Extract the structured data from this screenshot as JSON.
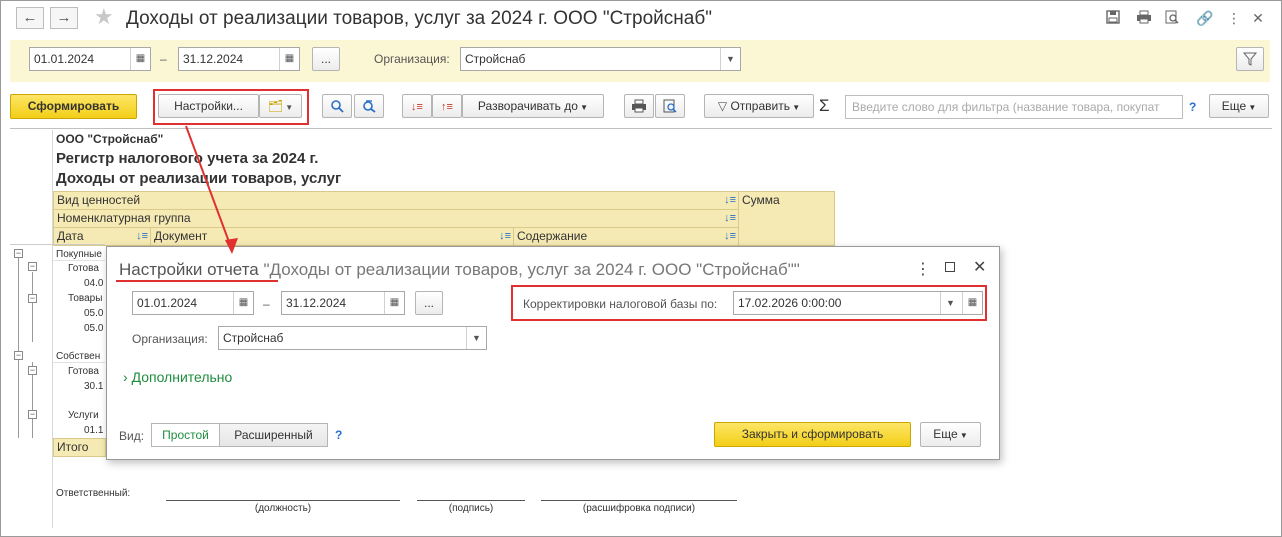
{
  "window": {
    "title": "Доходы от реализации товаров, услуг за 2024 г. ООО \"Стройснаб\"",
    "back_icon": "arrow-left-icon",
    "forward_icon": "arrow-right-icon",
    "more_icon": "more-vertical-icon"
  },
  "toolbar": {
    "date_from": "01.01.2024",
    "dash": "–",
    "date_to": "31.12.2024",
    "ellipsis": "...",
    "org_label": "Организация:",
    "org_value": "Стройснаб",
    "form_button": "Сформировать",
    "settings_button": "Настройки...",
    "expand_to_button": "Разворачивать до",
    "send_button": "Отправить",
    "sum_symbol": "Σ",
    "filter_placeholder": "Введите слово для фильтра (название товара, покупат",
    "help": "?",
    "more_button": "Еще"
  },
  "report": {
    "org": "ООО \"Стройснаб\"",
    "register_title": "Регистр налогового учета за 2024 г.",
    "report_title": "Доходы от реализации товаров, услуг",
    "header": {
      "kind": "Вид ценностей",
      "sum": "Сумма",
      "nomenclature_group": "Номенклатурная группа",
      "date": "Дата",
      "document": "Документ",
      "content": "Содержание"
    },
    "rows": [
      "Покупные",
      "Готова",
      "04.0",
      "Товары",
      "05.0",
      "05.0",
      "Собствен",
      "Готова",
      "30.1",
      "Услуги",
      "01.1"
    ],
    "total": "Итого",
    "responsible_label": "Ответственный:",
    "sig_position": "(должность)",
    "sig_signature": "(подпись)",
    "sig_decode": "(расшифровка подписи)"
  },
  "dialog": {
    "title_highlight": "Настройки отчета",
    "title_rest": "\"Доходы от реализации товаров, услуг за 2024 г. ООО \"Стройснаб\"\"",
    "date_from": "01.01.2024",
    "dash": "–",
    "date_to": "31.12.2024",
    "ellipsis": "...",
    "tax_base_label": "Корректировки налоговой базы по:",
    "tax_base_value": "17.02.2026  0:00:00",
    "org_label": "Организация:",
    "org_value": "Стройснаб",
    "additional": "Дополнительно",
    "view_label": "Вид:",
    "view_simple": "Простой",
    "view_extended": "Расширенный",
    "help": "?",
    "close_form_button": "Закрыть и сформировать",
    "more_button": "Еще"
  },
  "colors": {
    "accent_yellow": "#f3cf17",
    "panel_yellow": "#fbf7d4",
    "header_yellow": "#f5e9b4",
    "highlight_red": "#e03030",
    "link_green": "#1e8e3e"
  }
}
